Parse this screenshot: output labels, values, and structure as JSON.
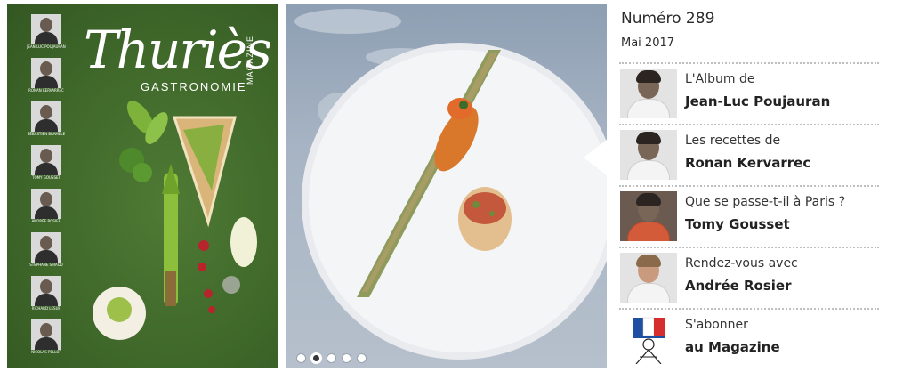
{
  "cover": {
    "logo_main": "Thuriès",
    "logo_sub": "GASTRONOMIE",
    "logo_magazine": "MAGAZINE",
    "chefs": [
      {
        "caption": "JEAN-LUC POUJAURAN"
      },
      {
        "caption": "RONAN KERVARREC"
      },
      {
        "caption": "SÉBASTIEN BRAMELE"
      },
      {
        "caption": "TOMY GOUSSET"
      },
      {
        "caption": "ANDRÉE ROSIER"
      },
      {
        "caption": "STÉPHANE SIRAUD"
      },
      {
        "caption": "RICHARD LESUR"
      },
      {
        "caption": "NICOLAS PELLOT"
      }
    ]
  },
  "slider": {
    "dots": 5,
    "active_index": 1
  },
  "panel": {
    "issue_number": "Numéro 289",
    "issue_date": "Mai 2017",
    "items": [
      {
        "line1": "L'Album de",
        "line2": "Jean-Luc Poujauran",
        "icon": "chef-portrait"
      },
      {
        "line1": "Les recettes de",
        "line2": "Ronan Kervarrec",
        "icon": "chef-portrait"
      },
      {
        "line1": "Que se passe-t-il à Paris ?",
        "line2": "Tomy Gousset",
        "icon": "chef-portrait"
      },
      {
        "line1": "Rendez-vous avec",
        "line2": "Andrée Rosier",
        "icon": "chef-portrait"
      },
      {
        "line1": "S'abonner",
        "line2": "au Magazine",
        "icon": "chef-hat-flag-icon"
      }
    ]
  },
  "colors": {
    "cover_green": "#3f682a",
    "flag_blue": "#1f4fa3",
    "flag_red": "#d62e2e"
  }
}
